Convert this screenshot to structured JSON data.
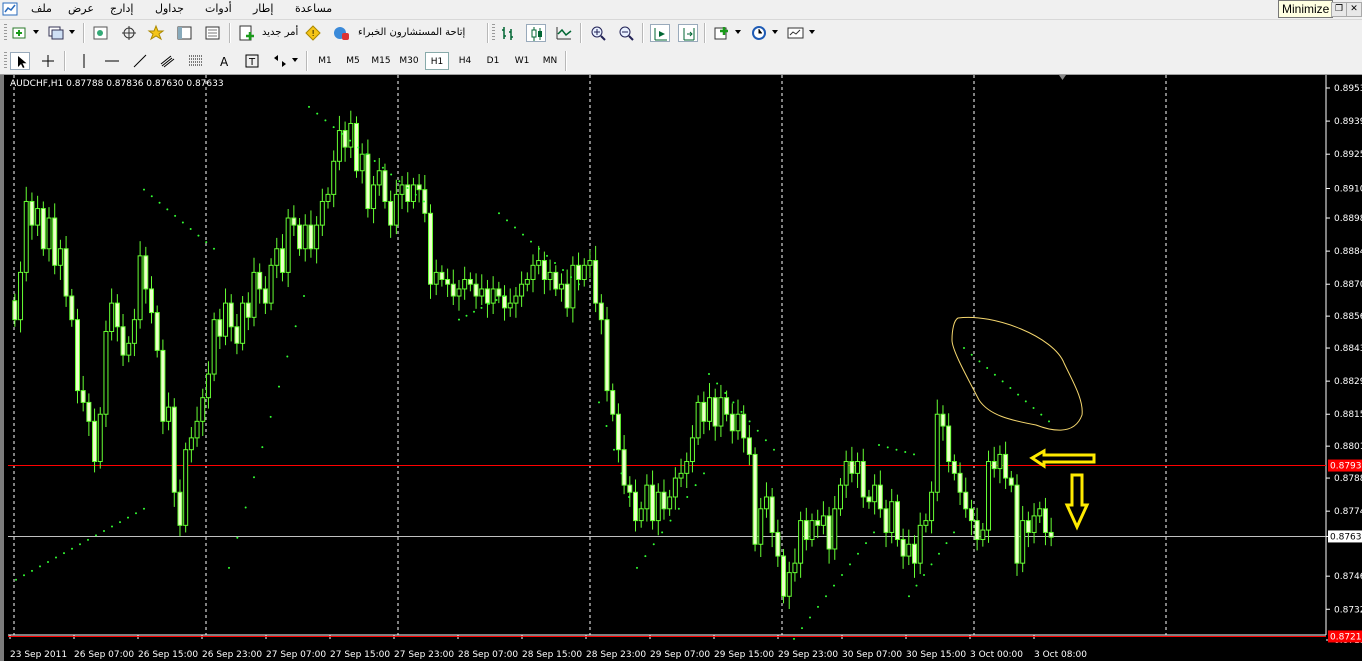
{
  "menu": {
    "items": [
      "ملف",
      "عرض",
      "إدارج",
      "جداول",
      "أدوات",
      "إطار",
      "مساعدة"
    ]
  },
  "window": {
    "tooltip": "Minimize"
  },
  "toolbar": {
    "new_order_label": "أمر جديد",
    "expert_advisors_label": "إتاحة المستشارون الخبراء",
    "timeframes": [
      "M1",
      "M5",
      "M15",
      "M30",
      "H1",
      "H4",
      "D1",
      "W1",
      "MN"
    ],
    "active_timeframe": "H1"
  },
  "chart_data": {
    "type": "candlestick",
    "title": "AUDCHF,H1  0.87788 0.87836 0.87630 0.87633",
    "symbol": "AUDCHF",
    "timeframe": "H1",
    "ohlc_latest": {
      "open": 0.87788,
      "high": 0.87836,
      "low": 0.8763,
      "close": 0.87633
    },
    "ylim": [
      0.87195,
      0.8953
    ],
    "y_ticks": [
      "0.89530",
      "0.89390",
      "0.89250",
      "0.89105",
      "0.88980",
      "0.88840",
      "0.88700",
      "0.88565",
      "0.88430",
      "0.88290",
      "0.88150",
      "0.88015",
      "0.87880",
      "0.87740",
      "0.87633",
      "0.87465",
      "0.87325",
      "0.87195"
    ],
    "x_ticks": [
      "23 Sep 2011",
      "26 Sep 07:00",
      "26 Sep 15:00",
      "26 Sep 23:00",
      "27 Sep 07:00",
      "27 Sep 15:00",
      "27 Sep 23:00",
      "28 Sep 07:00",
      "28 Sep 15:00",
      "28 Sep 23:00",
      "29 Sep 07:00",
      "29 Sep 15:00",
      "29 Sep 23:00",
      "30 Sep 07:00",
      "30 Sep 15:00",
      "3 Oct 00:00",
      "3 Oct 08:00"
    ],
    "horizontal_lines": [
      {
        "price": 0.87933,
        "label": "0.87933",
        "color": "#ff0000"
      },
      {
        "price": 0.8721,
        "label": "0.8721",
        "color": "#ff0000"
      }
    ],
    "current_price": {
      "price": 0.87633,
      "label": "0.87633"
    },
    "candle_closes": [
      0.8855,
      0.8875,
      0.8905,
      0.8895,
      0.8902,
      0.8885,
      0.8898,
      0.8878,
      0.8885,
      0.8865,
      0.8855,
      0.8825,
      0.882,
      0.8812,
      0.8795,
      0.8815,
      0.885,
      0.8862,
      0.8852,
      0.884,
      0.8845,
      0.8855,
      0.8882,
      0.8868,
      0.8858,
      0.8842,
      0.8812,
      0.8818,
      0.8782,
      0.8768,
      0.88,
      0.8805,
      0.8812,
      0.8822,
      0.8832,
      0.8855,
      0.8848,
      0.8862,
      0.8852,
      0.8845,
      0.8862,
      0.8856,
      0.8875,
      0.8868,
      0.8862,
      0.8878,
      0.8885,
      0.8875,
      0.8898,
      0.8895,
      0.8885,
      0.8895,
      0.8885,
      0.8895,
      0.8905,
      0.8908,
      0.8922,
      0.8935,
      0.8928,
      0.8938,
      0.8918,
      0.8925,
      0.8902,
      0.8912,
      0.8918,
      0.8905,
      0.8895,
      0.8908,
      0.8912,
      0.8905,
      0.8912,
      0.891,
      0.89,
      0.887,
      0.8875,
      0.8872,
      0.887,
      0.8865,
      0.8868,
      0.8872,
      0.887,
      0.8865,
      0.8868,
      0.8862,
      0.8868,
      0.8865,
      0.886,
      0.8862,
      0.8865,
      0.887,
      0.8872,
      0.8878,
      0.888,
      0.8872,
      0.8875,
      0.8868,
      0.887,
      0.886,
      0.8878,
      0.8872,
      0.8878,
      0.888,
      0.8862,
      0.8855,
      0.8825,
      0.8815,
      0.88,
      0.8785,
      0.8782,
      0.877,
      0.8775,
      0.8785,
      0.877,
      0.8782,
      0.8775,
      0.878,
      0.8788,
      0.879,
      0.8795,
      0.8805,
      0.882,
      0.8812,
      0.8822,
      0.881,
      0.8822,
      0.8815,
      0.8808,
      0.8815,
      0.8805,
      0.8798,
      0.876,
      0.8775,
      0.878,
      0.8765,
      0.8755,
      0.8738,
      0.8748,
      0.8752,
      0.877,
      0.8762,
      0.877,
      0.8768,
      0.8772,
      0.8758,
      0.8775,
      0.8785,
      0.8795,
      0.879,
      0.8795,
      0.878,
      0.8778,
      0.8785,
      0.8775,
      0.8765,
      0.8778,
      0.8762,
      0.8755,
      0.876,
      0.8752,
      0.8768,
      0.877,
      0.8782,
      0.8815,
      0.881,
      0.8795,
      0.879,
      0.8782,
      0.8775,
      0.877,
      0.8762,
      0.8766,
      0.8795,
      0.8792,
      0.8798,
      0.8788,
      0.8785,
      0.8752,
      0.877,
      0.8765,
      0.8772,
      0.8775,
      0.8765,
      0.8763
    ]
  }
}
